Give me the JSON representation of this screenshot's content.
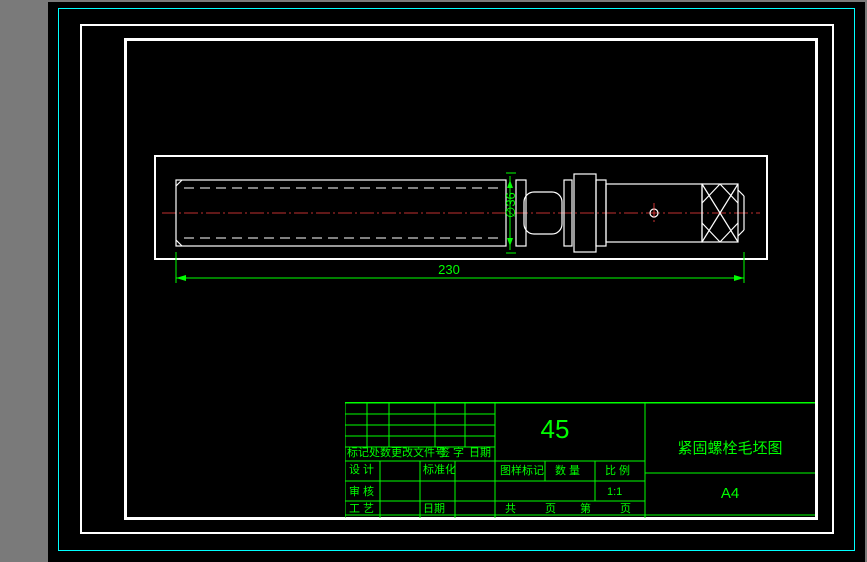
{
  "drawing": {
    "length_dim": "230",
    "diameter_dim": "∅36"
  },
  "titleblock": {
    "material": "45",
    "title": "紧固螺栓毛坯图",
    "sheet_size": "A4",
    "scale": "1:1",
    "row_revmark": "标记",
    "row_place": "处数",
    "row_changedoc": "更改文件号",
    "row_sign": "签 字",
    "row_date": "日期",
    "row_design": "设 计",
    "row_std": "标准化",
    "row_check": "审 核",
    "row_craft": "工 艺",
    "row_date2": "日期",
    "row_classmark": "图样标记",
    "row_qty": "数 量",
    "row_ratio": "比 例",
    "row_total": "共",
    "row_page": "页",
    "row_nth": "第",
    "row_page2": "页"
  }
}
